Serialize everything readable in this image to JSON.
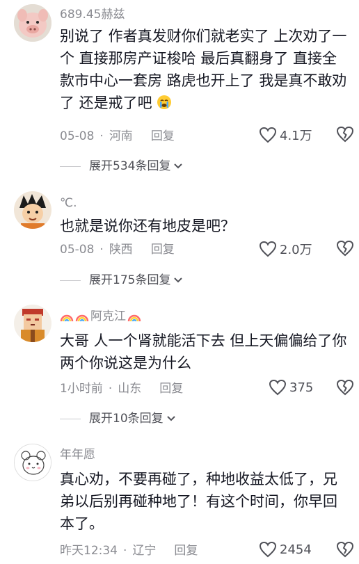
{
  "comments": [
    {
      "username": "689.45赫兹",
      "text": "别说了 作者真发财你们就老实了 上次劝了一个 直接那房产证梭哈 最后真翻身了 直接全款市中心一套房 路虎也开上了 我是真不敢劝了 还是戒了吧",
      "date": "05-08",
      "location": "河南",
      "reply_label": "回复",
      "likes": "4.1万",
      "expand_label": "展开534条回复",
      "avatar_icon": "pig-avatar-icon"
    },
    {
      "username": "℃.",
      "text": "也就是说你还有地皮是吧？",
      "date": "05-08",
      "location": "陕西",
      "reply_label": "回复",
      "likes": "2.0万",
      "expand_label": "展开175条回复",
      "avatar_icon": "cartoon-boy-avatar-icon"
    },
    {
      "username": "阿克江",
      "text": "大哥 人一个肾就能活下去 但上天偏偏给了你两个你说这是为什么",
      "date": "1小时前",
      "location": "山东",
      "reply_label": "回复",
      "likes": "375",
      "expand_label": "展开10条回复",
      "avatar_icon": "cartoon-character-avatar-icon"
    },
    {
      "username": "年年愿",
      "text": "真心劝，不要再碰了，种地收益太低了，兄弟以后别再碰种地了！有这个时间，你早回本了。",
      "date": "昨天12:34",
      "location": "辽宁",
      "reply_label": "回复",
      "likes": "2454",
      "avatar_icon": "sketch-bear-avatar-icon"
    }
  ]
}
